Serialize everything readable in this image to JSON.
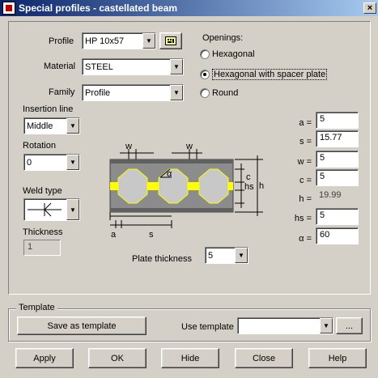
{
  "window": {
    "title": "Special profiles - castellated beam",
    "close_glyph": "×"
  },
  "profile": {
    "label": "Profile",
    "value": "HP 10x57"
  },
  "material": {
    "label": "Material",
    "value": "STEEL"
  },
  "family": {
    "label": "Family",
    "value": "Profile"
  },
  "openings": {
    "label": "Openings:",
    "options": [
      {
        "label": "Hexagonal",
        "checked": false
      },
      {
        "label": "Hexagonal with spacer plate",
        "checked": true
      },
      {
        "label": "Round",
        "checked": false
      }
    ]
  },
  "insertion": {
    "label": "Insertion line",
    "value": "Middle"
  },
  "rotation": {
    "label": "Rotation",
    "value": "0"
  },
  "weld": {
    "label": "Weld type"
  },
  "thickness": {
    "label": "Thickness",
    "value": "1"
  },
  "diagram": {
    "labels": {
      "w1": "w",
      "w2": "w",
      "alpha": "α",
      "c": "c",
      "hs": "hs",
      "h": "h",
      "a": "a",
      "s": "s"
    },
    "colors": {
      "beam": "#8c8c8c",
      "flange": "#606060",
      "weld": "#ffff00",
      "opening": "#c8c8c8"
    }
  },
  "params": [
    {
      "label": "a =",
      "value": "5",
      "readonly": false
    },
    {
      "label": "s =",
      "value": "15.77",
      "readonly": false
    },
    {
      "label": "w =",
      "value": "5",
      "readonly": false
    },
    {
      "label": "c =",
      "value": "5",
      "readonly": false
    },
    {
      "label": "h =",
      "value": "19.99",
      "readonly": true
    },
    {
      "label": "hs =",
      "value": "5",
      "readonly": false
    },
    {
      "label": "α =",
      "value": "60",
      "readonly": false
    }
  ],
  "plate": {
    "label": "Plate thickness",
    "value": "5"
  },
  "template": {
    "group_label": "Template",
    "save_label": "Save as template",
    "use_label": "Use template",
    "use_value": "",
    "browse_label": "..."
  },
  "buttons": {
    "apply": "Apply",
    "ok": "OK",
    "hide": "Hide",
    "close": "Close",
    "help": "Help"
  },
  "icons": {
    "dropdown": "▼",
    "profile_picker": "profile-picker-icon",
    "weld": "weld-symbol-icon"
  }
}
